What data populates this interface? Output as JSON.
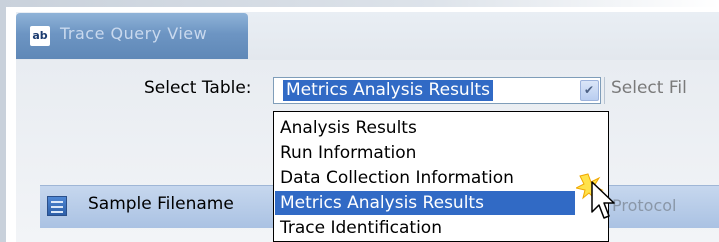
{
  "window": {
    "title": "Trace Query View",
    "app_icon_text": "ab"
  },
  "select_table": {
    "label": "Select Table:",
    "selected_value": "Metrics Analysis Results"
  },
  "select_file": {
    "label": "Select Fil"
  },
  "dropdown": {
    "options": [
      "Analysis Results",
      "Run Information",
      "Data Collection Information",
      "Metrics Analysis Results",
      "Trace Identification"
    ],
    "highlighted_index": 3
  },
  "table": {
    "columns": [
      "Sample Filename",
      "Protocol"
    ]
  },
  "colors": {
    "selection": "#316ac5",
    "title_tab": "#6d95c3",
    "header": "#b6cbe8"
  },
  "icons": [
    "table-icon",
    "dropdown-arrow-icon",
    "mouse-pointer-icon"
  ]
}
